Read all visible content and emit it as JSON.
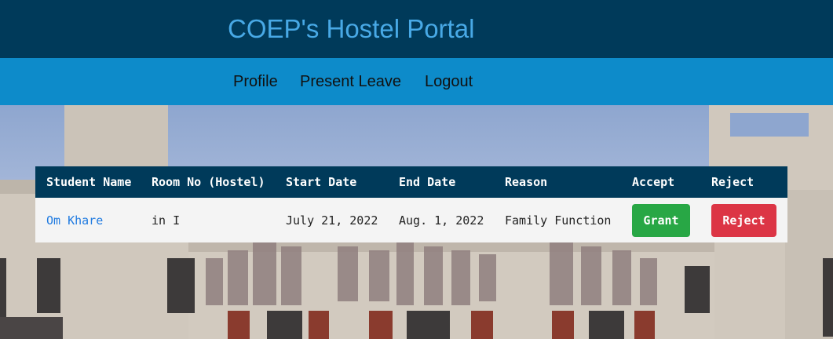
{
  "header": {
    "title": "COEP's Hostel Portal"
  },
  "nav": {
    "items": [
      {
        "label": "Profile"
      },
      {
        "label": "Present Leave"
      },
      {
        "label": "Logout"
      }
    ]
  },
  "leave_table": {
    "columns": [
      "Student Name",
      "Room No (Hostel)",
      "Start Date",
      "End Date",
      "Reason",
      "Accept",
      "Reject"
    ],
    "rows": [
      {
        "student_name": "Om Khare",
        "room": "in I",
        "start_date": "July 21, 2022",
        "end_date": "Aug. 1, 2022",
        "reason": "Family Function",
        "accept_label": "Grant",
        "reject_label": "Reject"
      }
    ]
  },
  "colors": {
    "header_bg": "#003a5a",
    "brand_text": "#48a9e6",
    "nav_bg": "#0d8bca",
    "grant_button": "#28a745",
    "reject_button": "#dc3545",
    "link": "#1f7ae0"
  }
}
